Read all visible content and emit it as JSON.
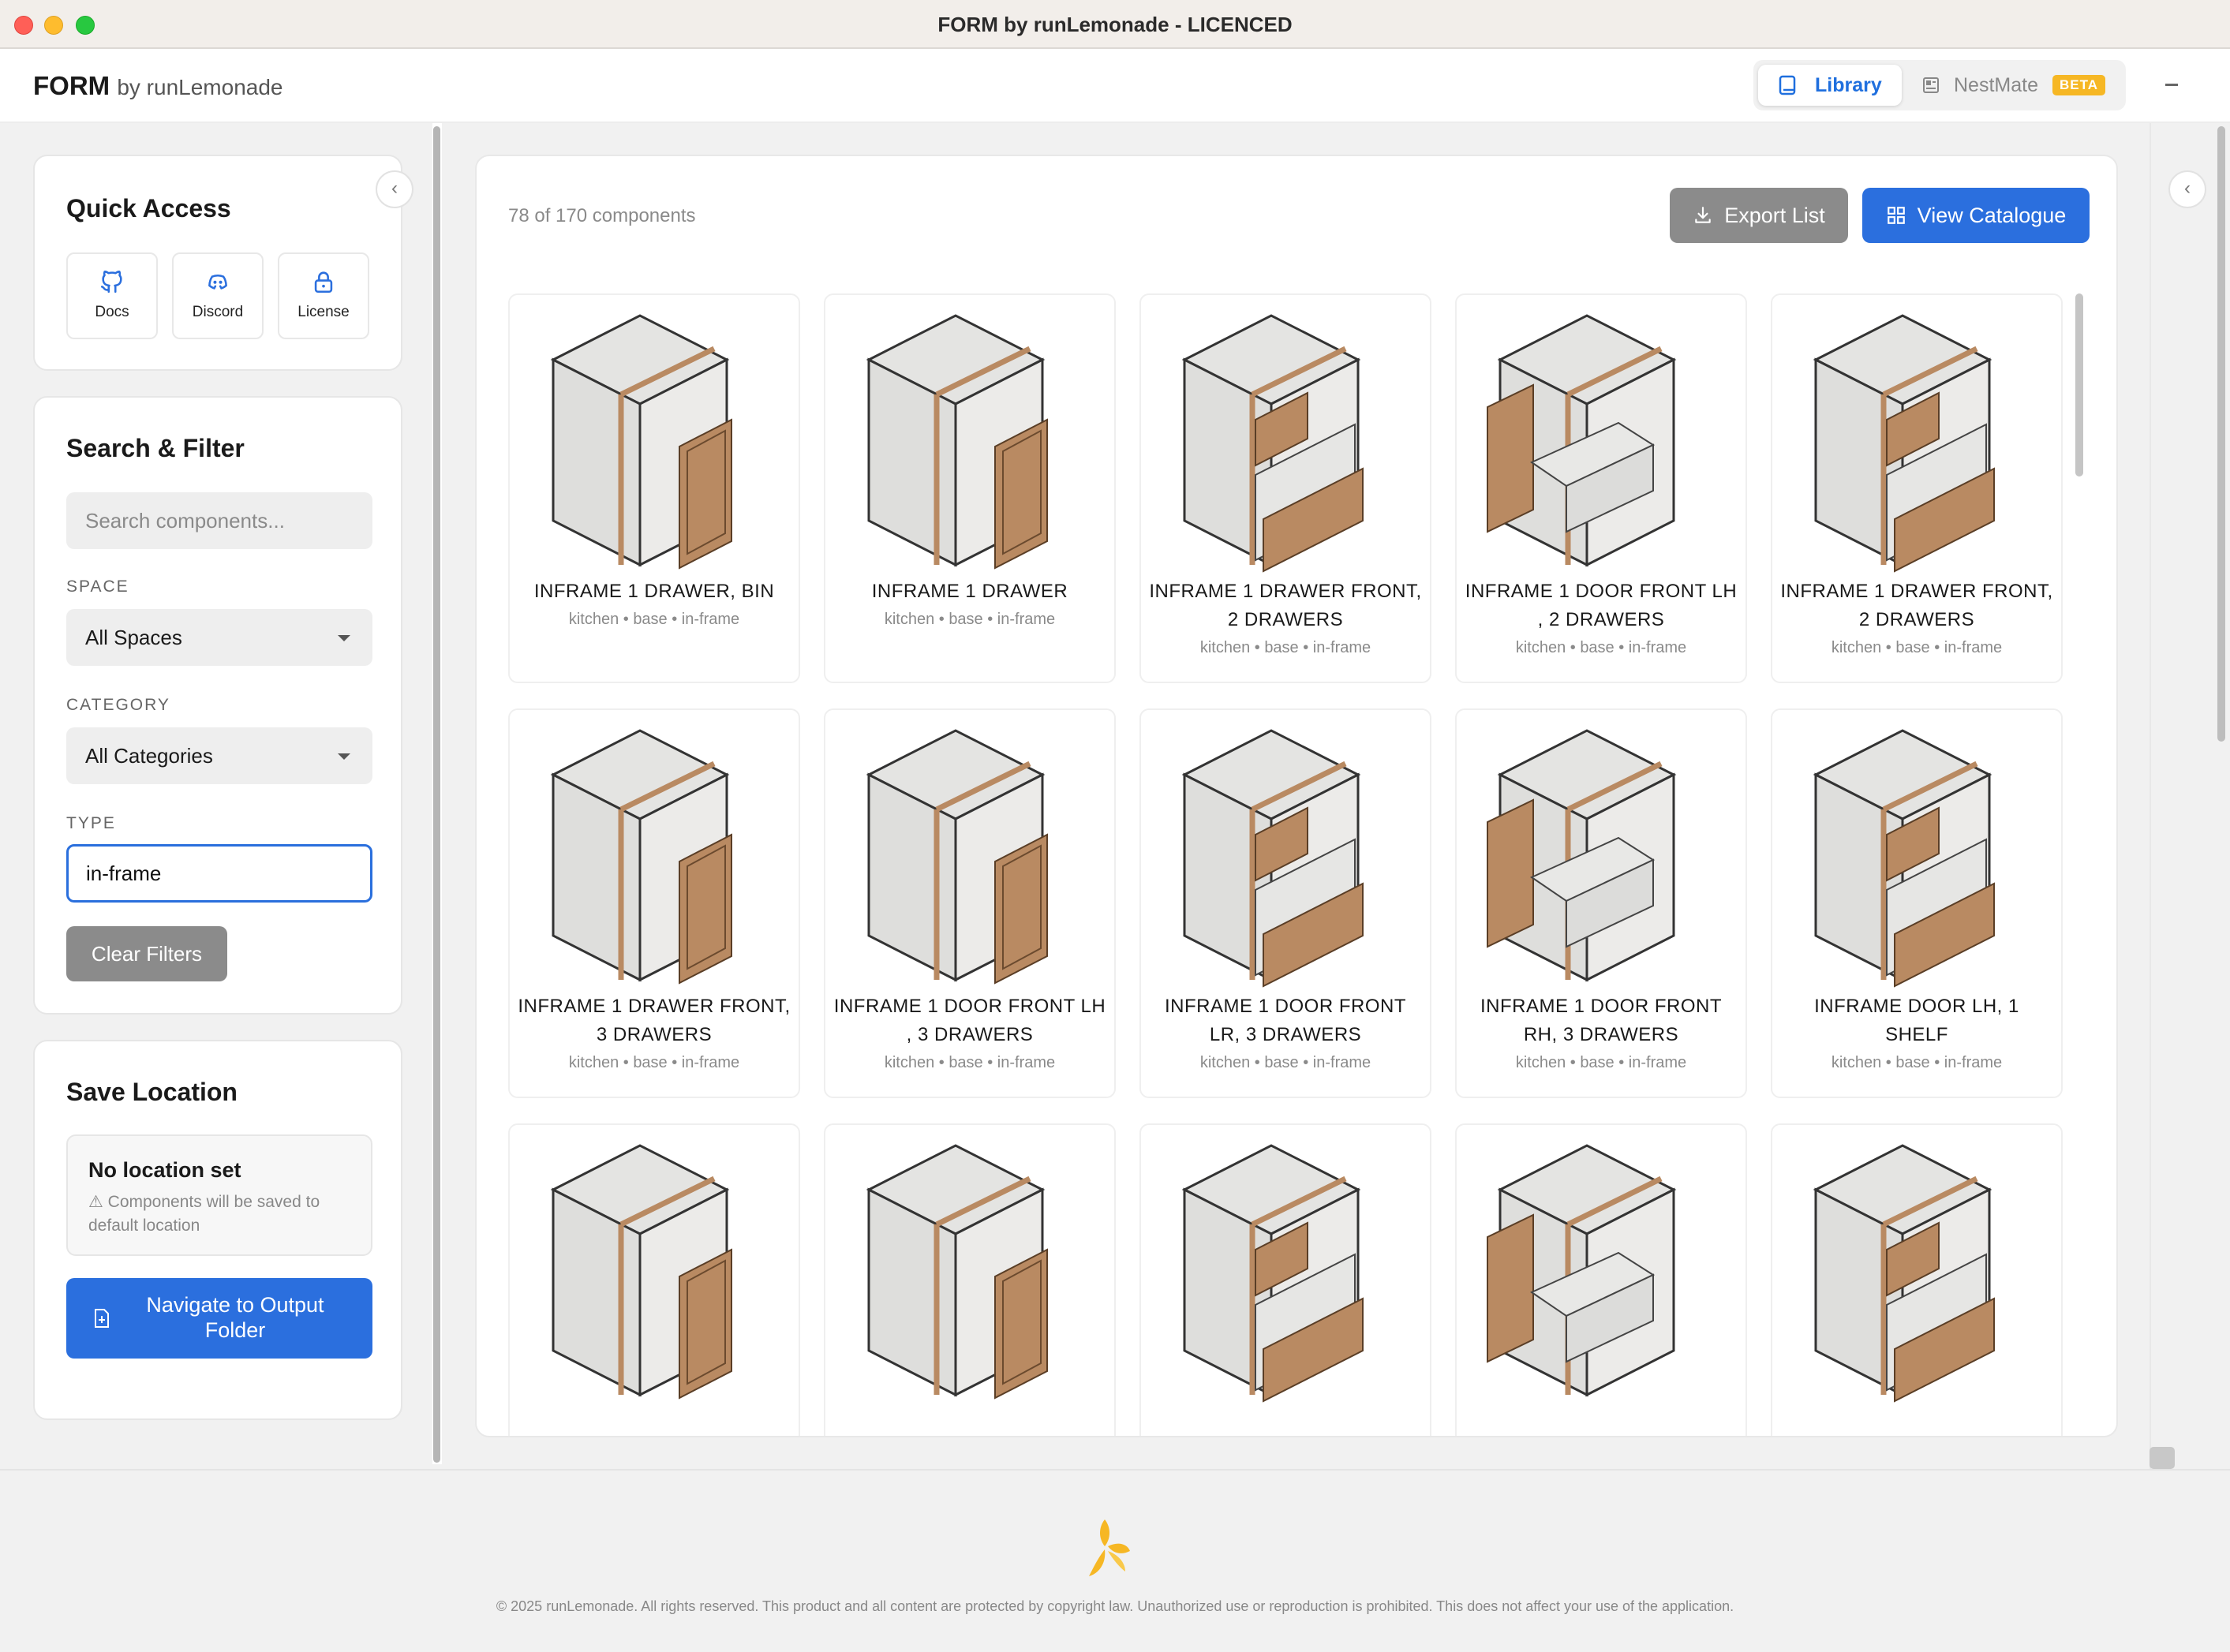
{
  "window": {
    "title": "FORM by runLemonade - LICENCED"
  },
  "header": {
    "brand_main": "FORM",
    "brand_sub": "by runLemonade",
    "tabs": [
      {
        "label": "Library",
        "icon": "book-icon",
        "active": true
      },
      {
        "label": "NestMate",
        "icon": "layout-icon",
        "badge": "BETA",
        "active": false
      }
    ]
  },
  "sidebar": {
    "quick_access": {
      "title": "Quick Access",
      "items": [
        {
          "label": "Docs",
          "icon": "github-icon"
        },
        {
          "label": "Discord",
          "icon": "discord-icon"
        },
        {
          "label": "License",
          "icon": "lock-icon"
        }
      ]
    },
    "search_filter": {
      "title": "Search & Filter",
      "search_placeholder": "Search components...",
      "space_label": "SPACE",
      "space_value": "All Spaces",
      "category_label": "CATEGORY",
      "category_value": "All Categories",
      "type_label": "TYPE",
      "type_value": "in-frame",
      "clear_label": "Clear Filters"
    },
    "save_location": {
      "title": "Save Location",
      "status_title": "No location set",
      "status_note": "⚠ Components will be saved to default location",
      "navigate_label": "Navigate to Output Folder"
    }
  },
  "main": {
    "count_text": "78 of 170 components",
    "export_label": "Export List",
    "catalogue_label": "View Catalogue",
    "components": [
      {
        "name": "INFRAME 1 DRAWER, BIN",
        "tags": "kitchen • base • in-frame"
      },
      {
        "name": "INFRAME 1 DRAWER",
        "tags": "kitchen • base • in-frame"
      },
      {
        "name": "INFRAME 1 DRAWER FRONT, 2 DRAWERS",
        "tags": "kitchen • base • in-frame"
      },
      {
        "name": "INFRAME 1 DOOR FRONT LH , 2 DRAWERS",
        "tags": "kitchen • base • in-frame"
      },
      {
        "name": "INFRAME 1 DRAWER FRONT, 2 DRAWERS",
        "tags": "kitchen • base • in-frame"
      },
      {
        "name": "INFRAME 1 DRAWER FRONT, 3 DRAWERS",
        "tags": "kitchen • base • in-frame"
      },
      {
        "name": "INFRAME 1 DOOR FRONT LH , 3 DRAWERS",
        "tags": "kitchen • base • in-frame"
      },
      {
        "name": "INFRAME 1 DOOR FRONT LR, 3 DRAWERS",
        "tags": "kitchen • base • in-frame"
      },
      {
        "name": "INFRAME 1 DOOR FRONT RH, 3 DRAWERS",
        "tags": "kitchen • base • in-frame"
      },
      {
        "name": "INFRAME DOOR LH, 1 SHELF",
        "tags": "kitchen • base • in-frame"
      },
      {
        "name": "",
        "tags": ""
      },
      {
        "name": "",
        "tags": ""
      },
      {
        "name": "",
        "tags": ""
      },
      {
        "name": "",
        "tags": ""
      },
      {
        "name": "",
        "tags": ""
      }
    ]
  },
  "footer": {
    "copyright": "© 2025 runLemonade. All rights reserved. This product and all content are protected by copyright law. Unauthorized use or reproduction is prohibited. This does not affect your use of the application."
  },
  "colors": {
    "accent": "#2b6fde",
    "beta": "#f6b724",
    "wood": "#b98a62",
    "lemon": "#f6b724"
  }
}
